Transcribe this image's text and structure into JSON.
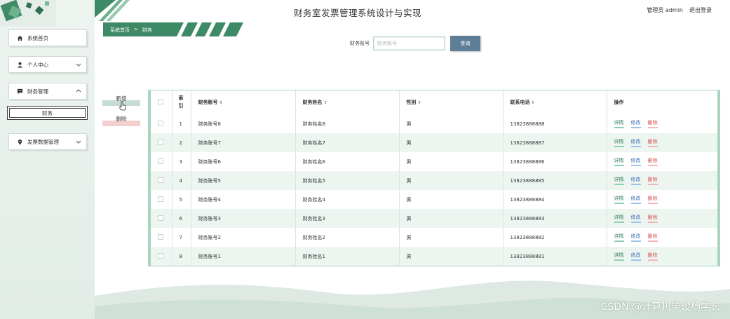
{
  "header": {
    "title": "财务室发票管理系统设计与实现",
    "user_label": "管理员 admin",
    "logout_label": "退出登录"
  },
  "breadcrumb": {
    "home": "系统首页",
    "separator": ">",
    "current": "财务"
  },
  "sidebar": {
    "items": [
      {
        "label": "系统首页",
        "icon": "home-icon"
      },
      {
        "label": "个人中心",
        "icon": "user-icon"
      },
      {
        "label": "财务管理",
        "icon": "chat-icon"
      },
      {
        "label": "财务",
        "icon": ""
      },
      {
        "label": "发票数据管理",
        "icon": "location-icon"
      }
    ]
  },
  "search": {
    "label": "财务账号",
    "placeholder": "财务账号",
    "button": "查询"
  },
  "actions": {
    "add": "新增",
    "delete": "删除"
  },
  "table": {
    "headers": {
      "index": "索引",
      "account": "财务账号",
      "name": "财务姓名",
      "gender": "性别",
      "phone": "联系电话",
      "ops": "操作"
    },
    "row_actions": {
      "detail": "详情",
      "edit": "修改",
      "delete": "删除"
    },
    "rows": [
      {
        "index": "1",
        "account": "财务账号8",
        "name": "财务姓名8",
        "gender": "男",
        "phone": "13823888888"
      },
      {
        "index": "2",
        "account": "财务账号7",
        "name": "财务姓名7",
        "gender": "男",
        "phone": "13823888887"
      },
      {
        "index": "3",
        "account": "财务账号6",
        "name": "财务姓名6",
        "gender": "男",
        "phone": "13823888886"
      },
      {
        "index": "4",
        "account": "财务账号5",
        "name": "财务姓名5",
        "gender": "男",
        "phone": "13823888885"
      },
      {
        "index": "5",
        "account": "财务账号4",
        "name": "财务姓名4",
        "gender": "男",
        "phone": "13823888884"
      },
      {
        "index": "6",
        "account": "财务账号3",
        "name": "财务姓名3",
        "gender": "男",
        "phone": "13823888883"
      },
      {
        "index": "7",
        "account": "财务账号2",
        "name": "财务姓名2",
        "gender": "男",
        "phone": "13823888882"
      },
      {
        "index": "8",
        "account": "财务账号1",
        "name": "财务姓名1",
        "gender": "男",
        "phone": "13823888881"
      }
    ]
  },
  "watermark": "CSDN @计算机毕设杨学长",
  "colors": {
    "accent": "#2e8b57",
    "search_button": "#5e7d97",
    "table_border": "#a9d4bd",
    "row_stripe": "#edf5f0"
  }
}
